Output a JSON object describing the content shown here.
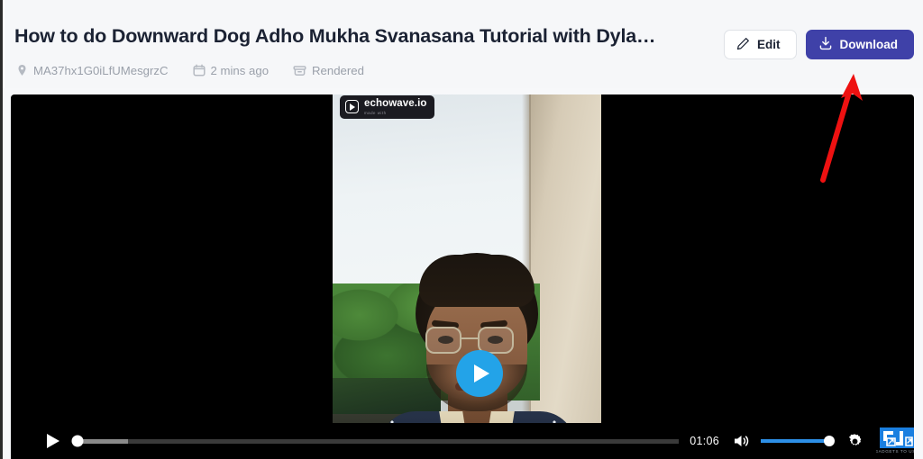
{
  "header": {
    "title": "How to do Downward Dog Adho Mukha Svanasana Tutorial with Dyla…",
    "meta": [
      {
        "icon": "location-pin-icon",
        "label": "MA37hx1G0iLfUMesgrzC"
      },
      {
        "icon": "calendar-icon",
        "label": "2 mins ago"
      },
      {
        "icon": "archive-box-icon",
        "label": "Rendered"
      }
    ],
    "buttons": {
      "edit_label": "Edit",
      "edit_icon": "pencil-icon",
      "download_label": "Download",
      "download_icon": "download-icon",
      "download_color": "#3f41a8",
      "edit_bg": "#ffffff"
    }
  },
  "video": {
    "watermark": {
      "brand": "echowave.io",
      "tagline": "made with",
      "icon": "echowave-play-logo-icon"
    },
    "play_overlay": {
      "icon": "play-icon",
      "color": "#23a3e8"
    },
    "controls": {
      "play_icon": "play-icon",
      "time": "01:06",
      "progress_percent": 0.6,
      "buffered_percent": 9,
      "volume_icon": "volume-high-icon",
      "volume_percent": 100,
      "volume_color": "#2d90e8",
      "settings_icon": "gear-icon",
      "logo_watermark": "gadgetstouse-logo-icon"
    }
  },
  "annotation": {
    "arrow": {
      "name": "red-arrow-annotation",
      "color": "#ee1111",
      "points_to": "download-button"
    }
  }
}
